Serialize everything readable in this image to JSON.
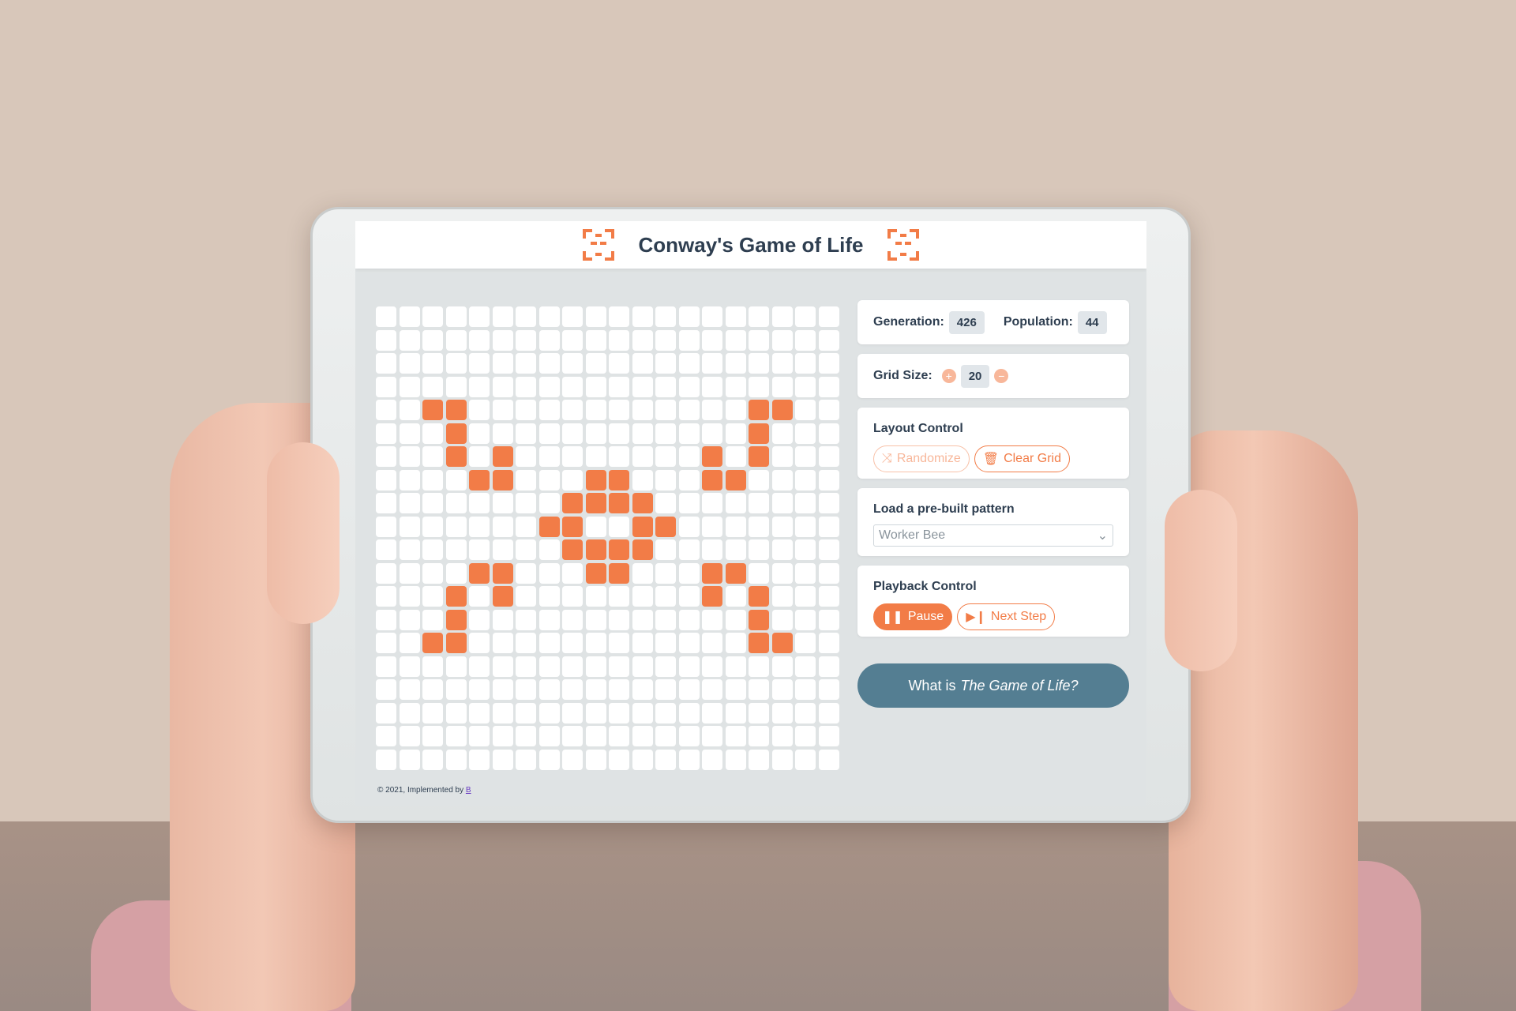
{
  "app": {
    "title": "Conway's Game of Life",
    "accent_color": "#f27c47",
    "cell_color": "#ffffff",
    "info_button_color": "#547e92"
  },
  "stats": {
    "generation_label": "Generation:",
    "generation_value": "426",
    "population_label": "Population:",
    "population_value": "44"
  },
  "grid_size": {
    "label": "Grid Size:",
    "value": "20",
    "increase_symbol": "+",
    "decrease_symbol": "−"
  },
  "layout_control": {
    "title": "Layout Control",
    "randomize_label": "Randomize",
    "clear_label": "Clear Grid"
  },
  "pattern": {
    "title": "Load a pre-built pattern",
    "selected": "Worker Bee"
  },
  "playback": {
    "title": "Playback Control",
    "pause_label": "Pause",
    "next_label": "Next Step"
  },
  "info": {
    "prefix": "What is",
    "emphasis": "The Game of Life?"
  },
  "footer": {
    "text": "© 2021, Implemented by",
    "link": "B"
  },
  "board": {
    "rows": 20,
    "cols": 20,
    "alive": [
      [
        4,
        2
      ],
      [
        4,
        3
      ],
      [
        4,
        16
      ],
      [
        4,
        17
      ],
      [
        5,
        3
      ],
      [
        5,
        16
      ],
      [
        6,
        3
      ],
      [
        6,
        5
      ],
      [
        6,
        14
      ],
      [
        6,
        16
      ],
      [
        7,
        4
      ],
      [
        7,
        5
      ],
      [
        7,
        9
      ],
      [
        7,
        10
      ],
      [
        7,
        14
      ],
      [
        7,
        15
      ],
      [
        8,
        8
      ],
      [
        8,
        9
      ],
      [
        8,
        10
      ],
      [
        8,
        11
      ],
      [
        9,
        7
      ],
      [
        9,
        8
      ],
      [
        9,
        11
      ],
      [
        9,
        12
      ],
      [
        10,
        8
      ],
      [
        10,
        9
      ],
      [
        10,
        10
      ],
      [
        10,
        11
      ],
      [
        11,
        4
      ],
      [
        11,
        5
      ],
      [
        11,
        9
      ],
      [
        11,
        10
      ],
      [
        11,
        14
      ],
      [
        11,
        15
      ],
      [
        12,
        3
      ],
      [
        12,
        5
      ],
      [
        12,
        14
      ],
      [
        12,
        16
      ],
      [
        13,
        3
      ],
      [
        13,
        16
      ],
      [
        14,
        2
      ],
      [
        14,
        3
      ],
      [
        14,
        16
      ],
      [
        14,
        17
      ]
    ]
  }
}
